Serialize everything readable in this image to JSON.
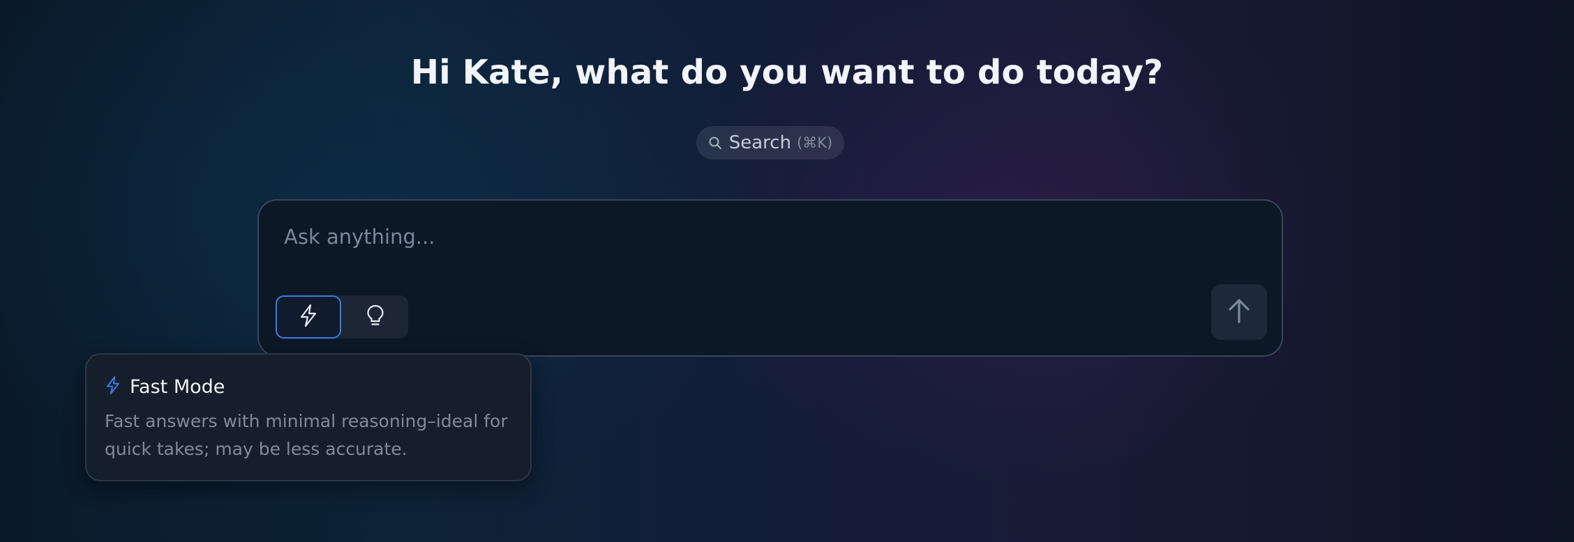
{
  "greeting": "Hi Kate, what do you want to do today?",
  "search": {
    "label": "Search",
    "shortcut": "(⌘K)",
    "icon": "search-icon"
  },
  "composer": {
    "placeholder": "Ask anything...",
    "value": "",
    "modes": [
      {
        "id": "fast",
        "icon": "lightning-bolt-icon",
        "selected": true
      },
      {
        "id": "think",
        "icon": "lightbulb-icon",
        "selected": false
      }
    ],
    "send_icon": "arrow-up-icon"
  },
  "tooltip": {
    "icon": "lightning-bolt-icon",
    "title": "Fast Mode",
    "description": "Fast answers with minimal reasoning–ideal for quick takes; may be less accurate."
  },
  "colors": {
    "accent": "#3f7ce8",
    "panel": "#0c1826",
    "border": "#39465a"
  }
}
